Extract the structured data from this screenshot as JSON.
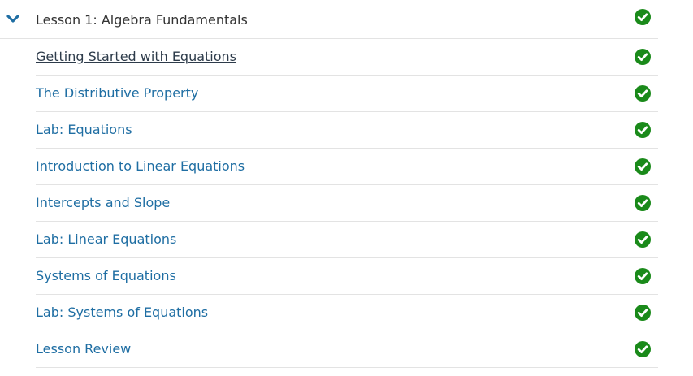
{
  "lesson": {
    "title": "Lesson 1: Algebra Fundamentals",
    "expanded": true,
    "completed": true
  },
  "items": [
    {
      "label": "Getting Started with Equations",
      "active": true,
      "completed": true
    },
    {
      "label": "The Distributive Property",
      "active": false,
      "completed": true
    },
    {
      "label": "Lab: Equations",
      "active": false,
      "completed": true
    },
    {
      "label": "Introduction to Linear Equations",
      "active": false,
      "completed": true
    },
    {
      "label": "Intercepts and Slope",
      "active": false,
      "completed": true
    },
    {
      "label": "Lab: Linear Equations",
      "active": false,
      "completed": true
    },
    {
      "label": "Systems of Equations",
      "active": false,
      "completed": true
    },
    {
      "label": "Lab: Systems of Equations",
      "active": false,
      "completed": true
    },
    {
      "label": "Lesson Review",
      "active": false,
      "completed": true
    }
  ],
  "colors": {
    "link": "#1f6ea3",
    "active_link": "#2d3b4a",
    "check_green": "#1a8a1a",
    "chevron_blue": "#1f6ea3",
    "divider": "#e3e3e3"
  },
  "icons": {
    "expand": "chevron-down-icon",
    "status": "check-circle-icon"
  }
}
